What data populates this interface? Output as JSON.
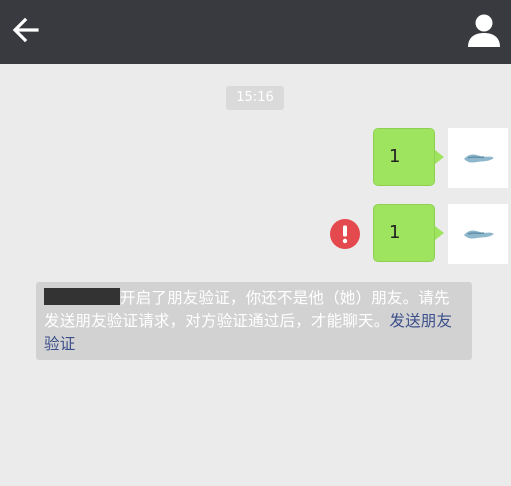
{
  "header": {
    "back_icon": "back-arrow-icon",
    "profile_icon": "person-icon"
  },
  "chat": {
    "timestamp": "15:16",
    "messages": [
      {
        "text": "1",
        "status": "sent"
      },
      {
        "text": "1",
        "status": "failed"
      }
    ],
    "system_notice": {
      "text": "开启了朋友验证，你还不是他（她）朋友。请先发送朋友验证请求，对方验证通过后，才能聊天。",
      "link_text": "发送朋友验证"
    }
  },
  "colors": {
    "topbar": "#393a3f",
    "bubble": "#9fe45e",
    "error": "#e4494d",
    "link": "#3b4f8a"
  }
}
